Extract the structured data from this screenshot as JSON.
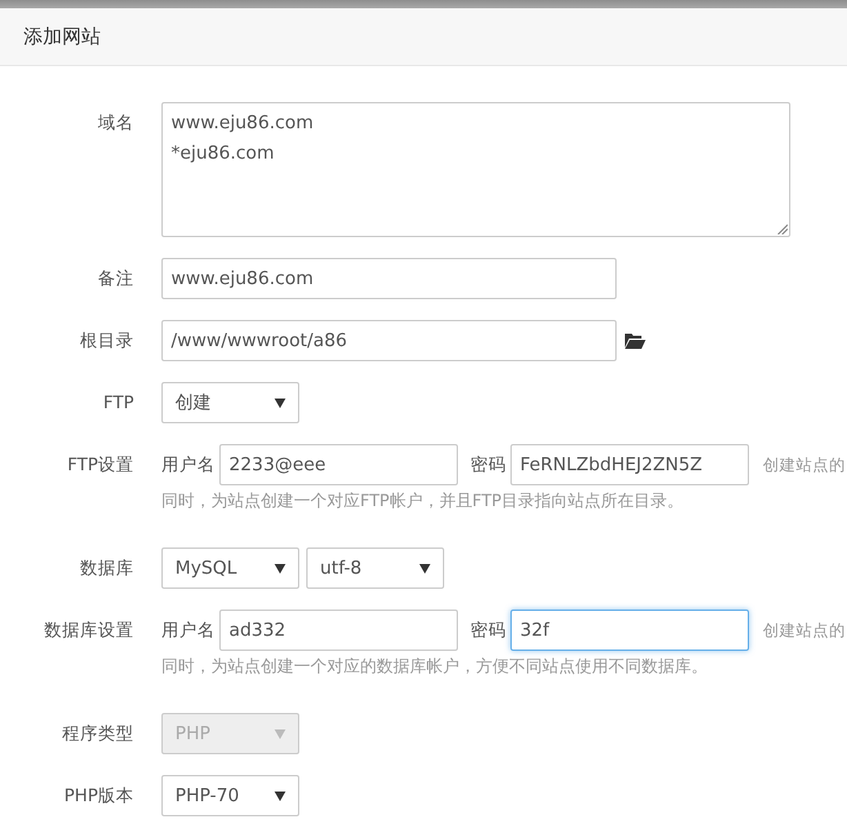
{
  "dialog": {
    "title": "添加网站"
  },
  "fields": [
    {
      "kind": "textarea",
      "label": "域名",
      "lines": [
        "www.eju86.com",
        "*eju86.com"
      ]
    },
    {
      "kind": "text",
      "label": "备注",
      "value": "www.eju86.com"
    },
    {
      "kind": "path",
      "label": "根目录",
      "value": "/www/wwwroot/a86"
    },
    {
      "kind": "select",
      "label": "FTP",
      "selects": [
        {
          "value": "创建",
          "disabled": false
        }
      ]
    },
    {
      "kind": "credentials",
      "label": "FTP设置",
      "user_label": "用户名",
      "user": "2233@eee",
      "password_label": "密码",
      "password": "FeRNLZbdHEJ2ZN5Z",
      "focused": false,
      "hint": "创建站点的",
      "hint_continued": "同时，为站点创建一个对应FTP帐户，并且FTP目录指向站点所在目录。"
    },
    {
      "kind": "select",
      "label": "数据库",
      "selects": [
        {
          "value": "MySQL",
          "disabled": false
        },
        {
          "value": "utf-8",
          "disabled": false
        }
      ]
    },
    {
      "kind": "credentials",
      "label": "数据库设置",
      "user_label": "用户名",
      "user": "ad332",
      "password_label": "密码",
      "password": "32f",
      "focused": true,
      "hint": "创建站点的",
      "hint_continued": "同时，为站点创建一个对应的数据库帐户，方便不同站点使用不同数据库。"
    },
    {
      "kind": "select",
      "label": "程序类型",
      "selects": [
        {
          "value": "PHP",
          "disabled": true
        }
      ]
    },
    {
      "kind": "select",
      "label": "PHP版本",
      "selects": [
        {
          "value": "PHP-70",
          "disabled": false
        }
      ]
    }
  ]
}
